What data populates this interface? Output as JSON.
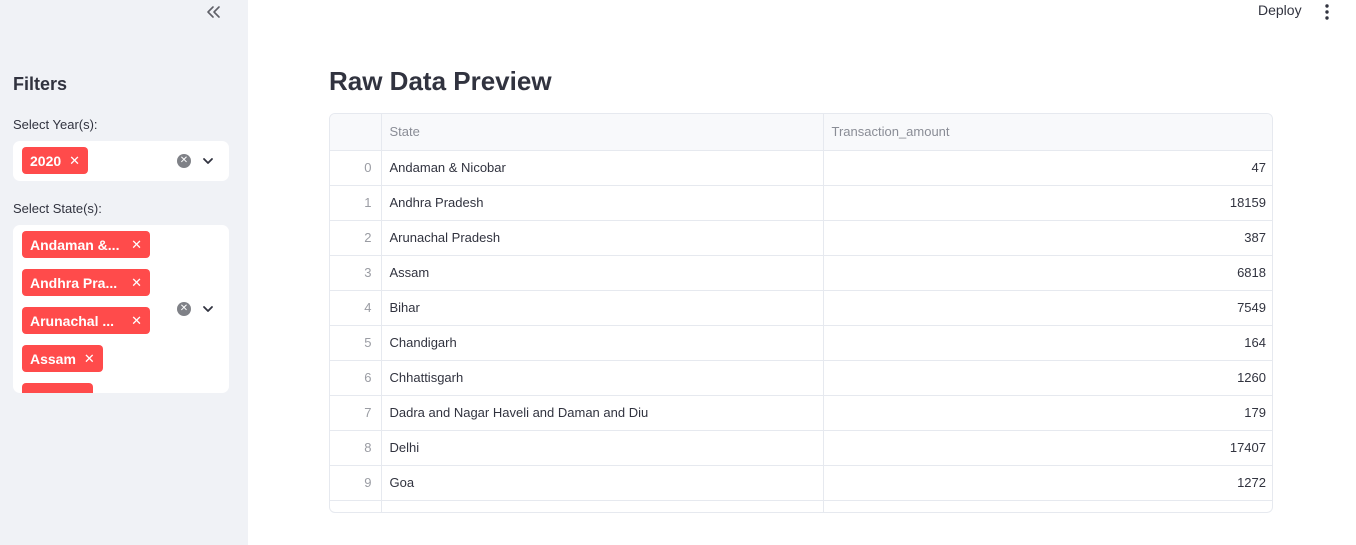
{
  "sidebar": {
    "title": "Filters",
    "year_filter": {
      "label": "Select Year(s):",
      "selected": [
        "2020"
      ]
    },
    "state_filter": {
      "label": "Select State(s):",
      "selected": [
        "Andaman &...",
        "Andhra Pra...",
        "Arunachal ...",
        "Assam"
      ]
    },
    "collapse_icon": "double-chevron-left-icon"
  },
  "header": {
    "deploy_label": "Deploy",
    "menu_icon": "kebab-menu-icon"
  },
  "main": {
    "title": "Raw Data Preview",
    "table": {
      "columns": [
        "",
        "State",
        "Transaction_amount"
      ],
      "rows": [
        {
          "index": "0",
          "state": "Andaman & Nicobar",
          "amount": "47"
        },
        {
          "index": "1",
          "state": "Andhra Pradesh",
          "amount": "18159"
        },
        {
          "index": "2",
          "state": "Arunachal Pradesh",
          "amount": "387"
        },
        {
          "index": "3",
          "state": "Assam",
          "amount": "6818"
        },
        {
          "index": "4",
          "state": "Bihar",
          "amount": "7549"
        },
        {
          "index": "5",
          "state": "Chandigarh",
          "amount": "164"
        },
        {
          "index": "6",
          "state": "Chhattisgarh",
          "amount": "1260"
        },
        {
          "index": "7",
          "state": "Dadra and Nagar Haveli and Daman and Diu",
          "amount": "179"
        },
        {
          "index": "8",
          "state": "Delhi",
          "amount": "17407"
        },
        {
          "index": "9",
          "state": "Goa",
          "amount": "1272"
        }
      ]
    }
  },
  "colors": {
    "accent": "#ff4b4b",
    "sidebar_bg": "#f0f2f6",
    "text": "#31333f"
  }
}
